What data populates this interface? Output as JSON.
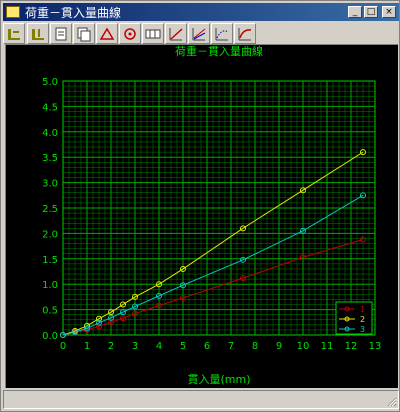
{
  "window": {
    "title": "荷重－貫入量曲線",
    "minimize_label": "_",
    "maximize_label": "□",
    "close_label": "×"
  },
  "toolbar": {
    "buttons": [
      {
        "name": "axis-settings-icon",
        "color": "#808000"
      },
      {
        "name": "axis-scale-icon",
        "color": "#808000"
      },
      {
        "name": "page-icon",
        "color": "#404040"
      },
      {
        "name": "copy-page-icon",
        "color": "#404040"
      },
      {
        "name": "triangle-icon",
        "color": "#c00000"
      },
      {
        "name": "target-icon",
        "color": "#c00000"
      },
      {
        "name": "data-table-icon",
        "color": "#404040"
      },
      {
        "name": "line-draw-icon",
        "color": "#c00000"
      },
      {
        "name": "multi-line-icon",
        "color": "#c00000"
      },
      {
        "name": "curve-dotted-icon",
        "color": "#0000c0"
      },
      {
        "name": "curve-fit-icon",
        "color": "#c00000"
      }
    ]
  },
  "status": {
    "text": ""
  },
  "chart_data": {
    "type": "line",
    "title": "荷重－貫入量曲線",
    "xlabel": "貫入量(mm)",
    "ylabel": "",
    "xlim": [
      0,
      13
    ],
    "ylim": [
      0,
      5
    ],
    "xticks": [
      "0",
      "1",
      "2",
      "3",
      "4",
      "5",
      "6",
      "7",
      "8",
      "9",
      "10",
      "11",
      "12",
      "13"
    ],
    "yticks": [
      "0.0",
      "0.5",
      "1.0",
      "1.5",
      "2.0",
      "2.5",
      "3.0",
      "3.5",
      "4.0",
      "4.5",
      "5.0"
    ],
    "grid": true,
    "grid_minor_x": 0.25,
    "grid_minor_y": 0.1,
    "legend_position": "bottom-right",
    "colors": {
      "background": "#000000",
      "grid": "#00a800",
      "axis_text": "#00e000",
      "title": "#00e000"
    },
    "series": [
      {
        "name": "1",
        "color": "#c00000",
        "x": [
          0,
          0.5,
          1.0,
          1.5,
          2.0,
          2.5,
          3.0,
          4.0,
          5.0,
          7.5,
          10.0,
          12.5
        ],
        "y": [
          0.0,
          0.05,
          0.1,
          0.17,
          0.25,
          0.33,
          0.42,
          0.58,
          0.73,
          1.12,
          1.53,
          1.88
        ]
      },
      {
        "name": "2",
        "color": "#e8e800",
        "x": [
          0,
          0.5,
          1.0,
          1.5,
          2.0,
          2.5,
          3.0,
          4.0,
          5.0,
          7.5,
          10.0,
          12.5
        ],
        "y": [
          0.0,
          0.08,
          0.18,
          0.32,
          0.45,
          0.6,
          0.75,
          1.0,
          1.3,
          2.1,
          2.85,
          3.6
        ]
      },
      {
        "name": "3",
        "color": "#00c8c8",
        "x": [
          0,
          0.5,
          1.0,
          1.5,
          2.0,
          2.5,
          3.0,
          4.0,
          5.0,
          7.5,
          10.0,
          12.5
        ],
        "y": [
          0.0,
          0.06,
          0.13,
          0.24,
          0.34,
          0.45,
          0.56,
          0.77,
          0.98,
          1.48,
          2.05,
          2.75
        ]
      }
    ]
  }
}
